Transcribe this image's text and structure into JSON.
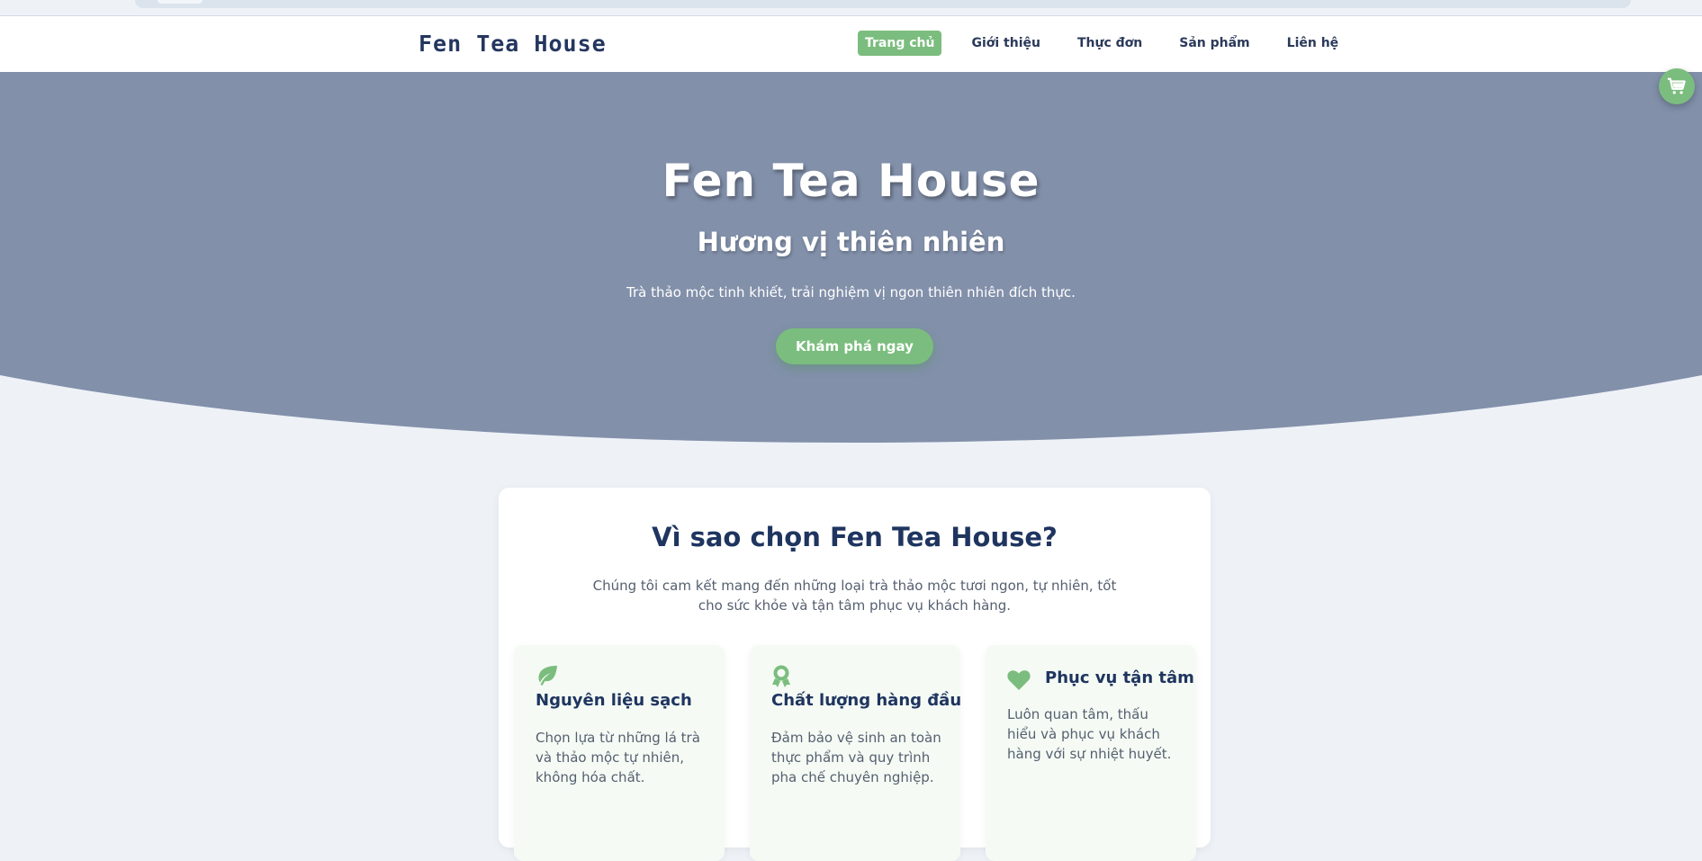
{
  "nav": {
    "logo": "Fen Tea House",
    "items": [
      {
        "label": "Trang chủ"
      },
      {
        "label": "Giới thiệu"
      },
      {
        "label": "Thực đơn"
      },
      {
        "label": "Sản phẩm"
      },
      {
        "label": "Liên hệ"
      }
    ]
  },
  "hero": {
    "title": "Fen Tea House",
    "subtitle": "Hương vị thiên nhiên",
    "description": "Trà thảo mộc tinh khiết, trải nghiệm vị ngon thiên nhiên đích thực.",
    "cta_label": "Khám phá ngay"
  },
  "why": {
    "title": "Vì sao chọn Fen Tea House?",
    "description": "Chúng tôi cam kết mang đến những loại trà thảo mộc tươi ngon, tự nhiên, tốt cho sức khỏe và tận tâm phục vụ khách hàng.",
    "features": [
      {
        "icon": "leaf-icon",
        "title": "Nguyên liệu sạch",
        "text": "Chọn lựa từ những lá trà và thảo mộc tự nhiên, không hóa chất."
      },
      {
        "icon": "award-icon",
        "title": "Chất lượng hàng đầu",
        "text": "Đảm bảo vệ sinh an toàn thực phẩm và quy trình pha chế chuyên nghiệp."
      },
      {
        "icon": "heart-icon",
        "title": "Phục vụ tận tâm",
        "text": "Luôn quan tâm, thấu hiểu và phục vụ khách hàng với sự nhiệt huyết."
      }
    ]
  },
  "colors": {
    "accent": "#7bbd7e",
    "hero_bg": "#8290aa",
    "heading": "#1f3560",
    "page_bg": "#eef2f7"
  },
  "cart": {
    "icon": "cart-icon"
  }
}
